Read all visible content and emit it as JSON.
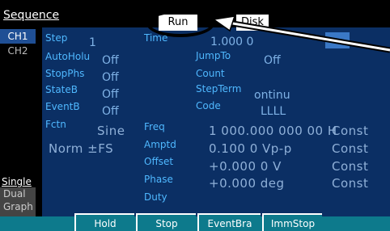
{
  "header": {
    "title": "Sequence",
    "run_tab": "Run",
    "disk_tab": "Disk"
  },
  "channels": {
    "ch1": "CH1",
    "ch2": "CH2"
  },
  "left_modes": {
    "single": "Single",
    "dual_line1": "Dual",
    "dual_line2": "Graph"
  },
  "params": {
    "step": {
      "label": "Step",
      "value": "1"
    },
    "time": {
      "label": "Time",
      "value": "1.000 0"
    },
    "autoholu": {
      "label": "AutoHolu",
      "value": "Off"
    },
    "jumpto": {
      "label": "JumpTo",
      "value": "Off"
    },
    "stopphs": {
      "label": "StopPhs",
      "value": "Off"
    },
    "count": {
      "label": "Count"
    },
    "stateb": {
      "label": "StateB",
      "value": "Off"
    },
    "stepterm": {
      "label": "StepTerm",
      "value": "ontinu"
    },
    "eventb": {
      "label": "EventB",
      "value": "Off"
    },
    "code": {
      "label": "Code",
      "value": "LLLL"
    }
  },
  "waveform": {
    "fctn_label": "Fctn",
    "fctn_value": "Sine",
    "range_value": "Norm ±FS",
    "freq_label": "Freq",
    "freq_value": "1 000.000 000 00 H",
    "freq_mode": "Const",
    "amptd_label": "Amptd",
    "amptd_value": "0.100 0 Vp-p",
    "amptd_mode": "Const",
    "offset_label": "Offset",
    "offset_value": "+0.000 0 V",
    "offset_mode": "Const",
    "phase_label": "Phase",
    "phase_value": "+0.000 deg",
    "phase_mode": "Const",
    "duty_label": "Duty"
  },
  "softkeys": {
    "k1": "Hold",
    "k2": "Stop",
    "k3": "EventBra",
    "k4": "ImmStop"
  },
  "colors": {
    "accent": "#4fb8ff",
    "background": "#0b2f64",
    "softkey": "#0d7a8c"
  }
}
